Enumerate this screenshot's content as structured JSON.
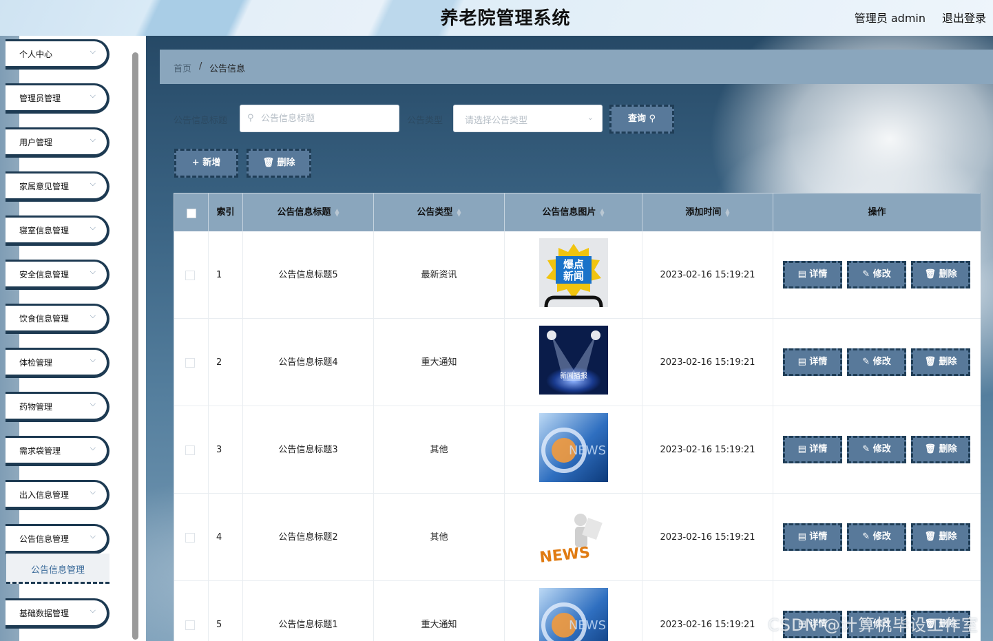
{
  "header": {
    "title": "养老院管理系统",
    "admin_label": "管理员 admin",
    "logout_label": "退出登录"
  },
  "sidebar": {
    "items": [
      {
        "label": "个人中心"
      },
      {
        "label": "管理员管理"
      },
      {
        "label": "用户管理"
      },
      {
        "label": "家属意见管理"
      },
      {
        "label": "寝室信息管理"
      },
      {
        "label": "安全信息管理"
      },
      {
        "label": "饮食信息管理"
      },
      {
        "label": "体检管理"
      },
      {
        "label": "药物管理"
      },
      {
        "label": "需求袋管理"
      },
      {
        "label": "出入信息管理"
      },
      {
        "label": "公告信息管理"
      },
      {
        "label": "基础数据管理"
      }
    ],
    "active_sub": "公告信息管理"
  },
  "breadcrumb": {
    "home": "首页",
    "separator": "/",
    "current": "公告信息"
  },
  "filters": {
    "title_label": "公告信息标题",
    "title_placeholder": "公告信息标题",
    "type_label": "公告类型",
    "type_placeholder": "请选择公告类型",
    "query_label": "查询"
  },
  "actions": {
    "add_label": "新增",
    "delete_label": "删除"
  },
  "table": {
    "columns": [
      "索引",
      "公告信息标题",
      "公告类型",
      "公告信息图片",
      "添加时间",
      "操作"
    ],
    "row_actions": {
      "detail": "详情",
      "edit": "修改",
      "delete": "删除"
    },
    "rows": [
      {
        "index": "1",
        "title": "公告信息标题5",
        "type": "最新资讯",
        "image_text": "爆点新闻",
        "time": "2023-02-16 15:19:21"
      },
      {
        "index": "2",
        "title": "公告信息标题4",
        "type": "重大通知",
        "image_text": "新闻播报",
        "time": "2023-02-16 15:19:21"
      },
      {
        "index": "3",
        "title": "公告信息标题3",
        "type": "其他",
        "image_text": "NEWS",
        "time": "2023-02-16 15:19:21"
      },
      {
        "index": "4",
        "title": "公告信息标题2",
        "type": "其他",
        "image_text": "NEWS",
        "time": "2023-02-16 15:19:21"
      },
      {
        "index": "5",
        "title": "公告信息标题1",
        "type": "重大通知",
        "image_text": "NEWS",
        "time": "2023-02-16 15:19:21"
      }
    ]
  },
  "watermark": "CSDN @计算机毕设工作室",
  "colors": {
    "accent": "#58799a",
    "dark": "#1d3a52",
    "header_bg": "#8aa6bd"
  }
}
